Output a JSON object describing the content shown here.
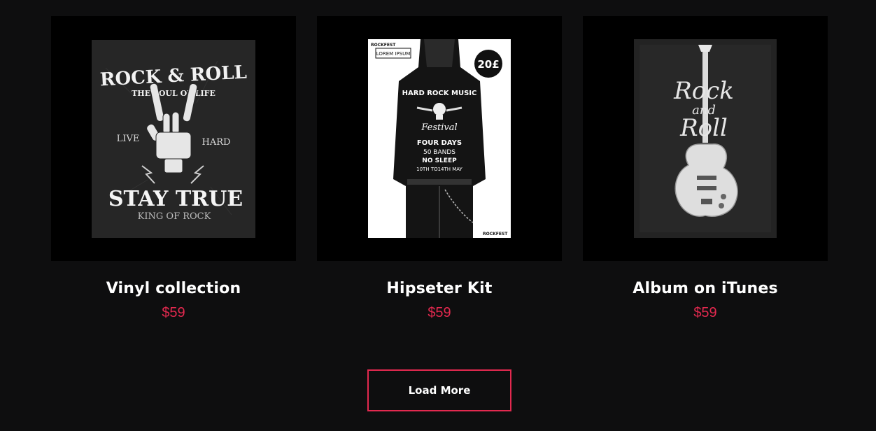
{
  "products": [
    {
      "title": "Vinyl collection",
      "price": "$59",
      "image_text": {
        "line1": "ROCK & ROLL",
        "line2": "THE SOUL OF LIFE",
        "left": "LIVE",
        "right": "HARD",
        "line3": "STAY TRUE",
        "line4": "KING OF ROCK"
      },
      "icon": "skeleton-rock-hand-icon"
    },
    {
      "title": "Hipseter Kit",
      "price": "$59",
      "image_text": {
        "tag": "LOREM IPSUM",
        "price_badge": "20£",
        "headline": "HARD ROCK MUSIC",
        "script": "Festival",
        "days": "FOUR DAYS",
        "bands": "50 BANDS",
        "sleep": "NO SLEEP",
        "dates": "10TH TO14TH MAY",
        "side": "ROCKFEST"
      },
      "icon": "leather-jacket-poster-icon"
    },
    {
      "title": "Album on iTunes",
      "price": "$59",
      "image_text": {
        "line1": "Rock",
        "line2": "and",
        "line3": "Roll"
      },
      "icon": "electric-guitar-icon"
    }
  ],
  "load_more_label": "Load More",
  "colors": {
    "background": "#0e0e0f",
    "accent": "#e3294f",
    "title": "#ffffff"
  }
}
